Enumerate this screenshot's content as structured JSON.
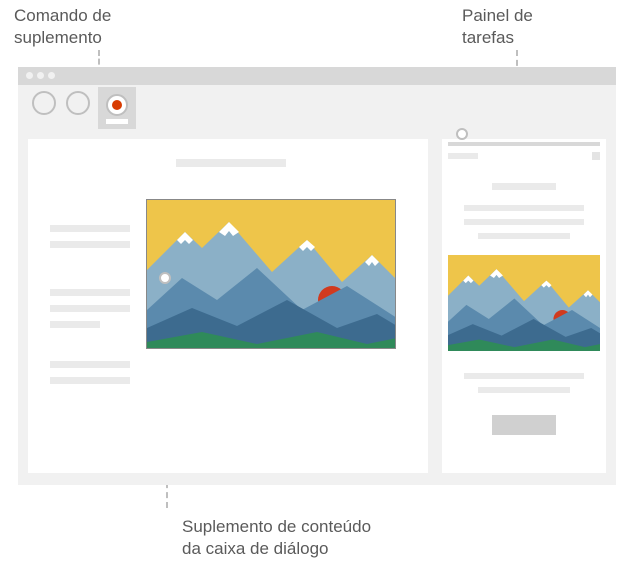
{
  "labels": {
    "addin_command": "Comando de\nsuplemento",
    "task_pane": "Painel de\ntarefas",
    "content_addin": "Suplemento de conteúdo\nda caixa de diálogo"
  },
  "illustration": {
    "sky_color": "#eec54a",
    "mountain_far": "#8bb0c7",
    "mountain_mid": "#5b8aad",
    "mountain_near": "#3d6b8f",
    "sun_color": "#d13a1e",
    "ground_color": "#2f8a5a",
    "snow_color": "#ffffff"
  }
}
